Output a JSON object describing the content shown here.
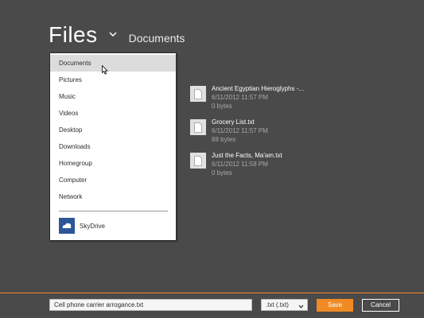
{
  "header": {
    "title": "Files",
    "location": "Documents"
  },
  "dropdown": {
    "items": [
      {
        "label": "Documents",
        "selected": true
      },
      {
        "label": "Pictures"
      },
      {
        "label": "Music"
      },
      {
        "label": "Videos"
      },
      {
        "label": "Desktop"
      },
      {
        "label": "Downloads"
      },
      {
        "label": "Homegroup"
      },
      {
        "label": "Computer"
      },
      {
        "label": "Network"
      }
    ],
    "skydrive": {
      "label": "SkyDrive",
      "icon": "skydrive-icon"
    }
  },
  "files": [
    {
      "name": "Ancient Egyptian Hieroglyphs -...",
      "date": "6/11/2012 11:57 PM",
      "size": "0 bytes"
    },
    {
      "name": "Grocery List.txt",
      "date": "6/11/2012 11:57 PM",
      "size": "88 bytes"
    },
    {
      "name": "Just the Facts, Ma'am.txt",
      "date": "6/11/2012 11:58 PM",
      "size": "0 bytes"
    }
  ],
  "footer": {
    "filename": "Cell phone carrier arrogance.txt",
    "filetype": ".txt (.txt)",
    "save_label": "Save",
    "cancel_label": "Cancel"
  },
  "colors": {
    "background": "#4a4a4a",
    "accent": "#f08a24",
    "skydrive": "#2b5797"
  }
}
